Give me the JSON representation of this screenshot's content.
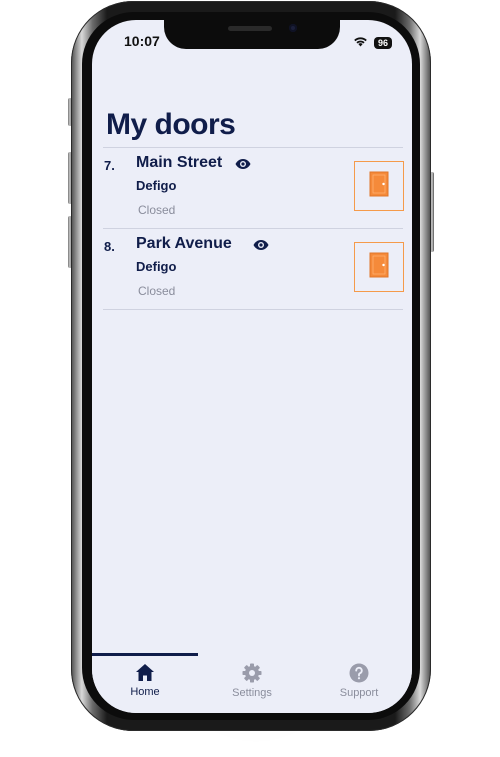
{
  "status_bar": {
    "time": "10:07",
    "battery": "96",
    "wifi_icon": "wifi-icon"
  },
  "page": {
    "title": "My doors"
  },
  "doors": [
    {
      "number": "7.",
      "name": "Main Street",
      "vendor": "Defigo",
      "state": "Closed",
      "visibility_icon": "eye-icon",
      "action_icon": "door-icon"
    },
    {
      "number": "8.",
      "name": "Park Avenue",
      "vendor": "Defigo",
      "state": "Closed",
      "visibility_icon": "eye-icon",
      "action_icon": "door-icon"
    }
  ],
  "nav": {
    "items": [
      {
        "label": "Home",
        "icon": "home-icon",
        "active": true
      },
      {
        "label": "Settings",
        "icon": "gear-icon",
        "active": false
      },
      {
        "label": "Support",
        "icon": "help-icon",
        "active": false
      }
    ]
  },
  "colors": {
    "screen_background": "#eceef8",
    "primary_text": "#101d4a",
    "secondary_text": "#8a8d9c",
    "accent_orange": "#f59a4a",
    "door_fill": "#f58a3a"
  }
}
